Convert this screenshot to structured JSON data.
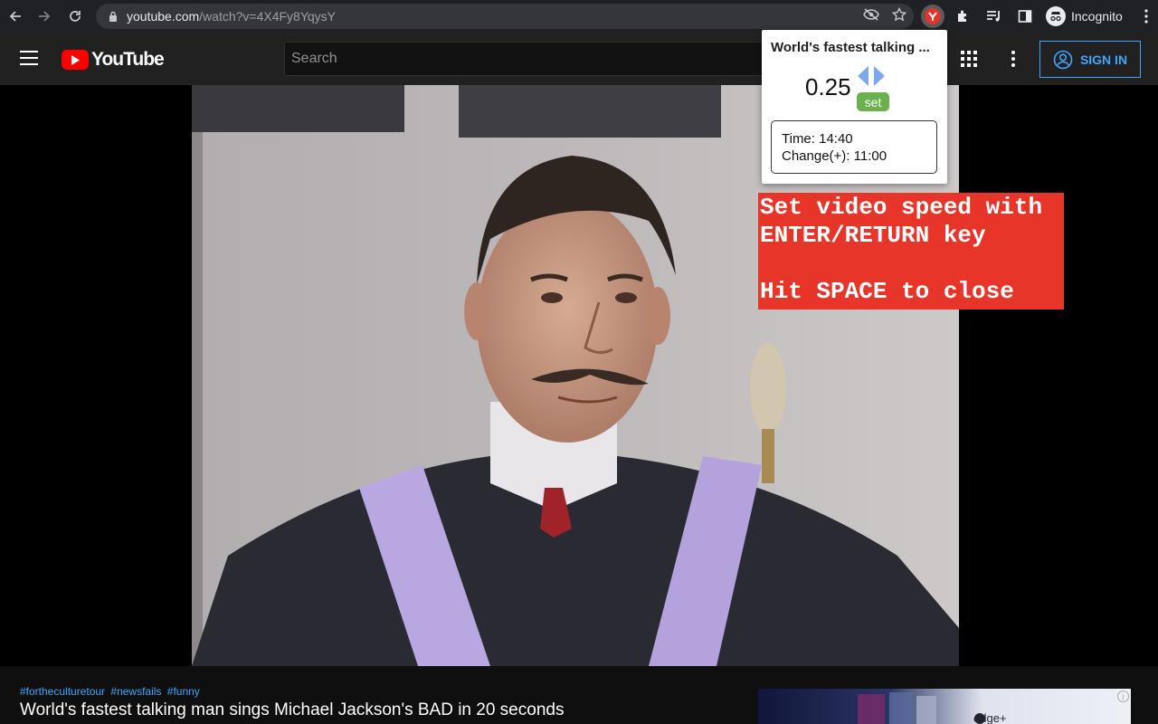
{
  "browser": {
    "url_host": "youtube.com",
    "url_path": "/watch?v=4X4Fy8YqysY",
    "profile_label": "Incognito"
  },
  "youtube": {
    "logo_text": "YouTube",
    "search_placeholder": "Search",
    "sign_in_label": "SIGN IN"
  },
  "video": {
    "hashtags": [
      "#fortheculturetour",
      "#newsfails",
      "#funny"
    ],
    "title": "World's fastest talking man sings Michael Jackson's BAD in 20 seconds"
  },
  "ad": {
    "brand_text": "edge+"
  },
  "speed_popup": {
    "title": "World's fastest talking ...",
    "speed_value": "0.25",
    "set_label": "set",
    "time_line": "Time: 14:40",
    "change_line": "Change(+): 11:00"
  },
  "hint": {
    "text": "Set video speed with\nENTER/RETURN key\n\nHit SPACE to close"
  },
  "colors": {
    "yt_red": "#ff0000",
    "hint_bg": "#e8352a",
    "set_green": "#6ab04c",
    "link_blue": "#3ea6ff"
  }
}
